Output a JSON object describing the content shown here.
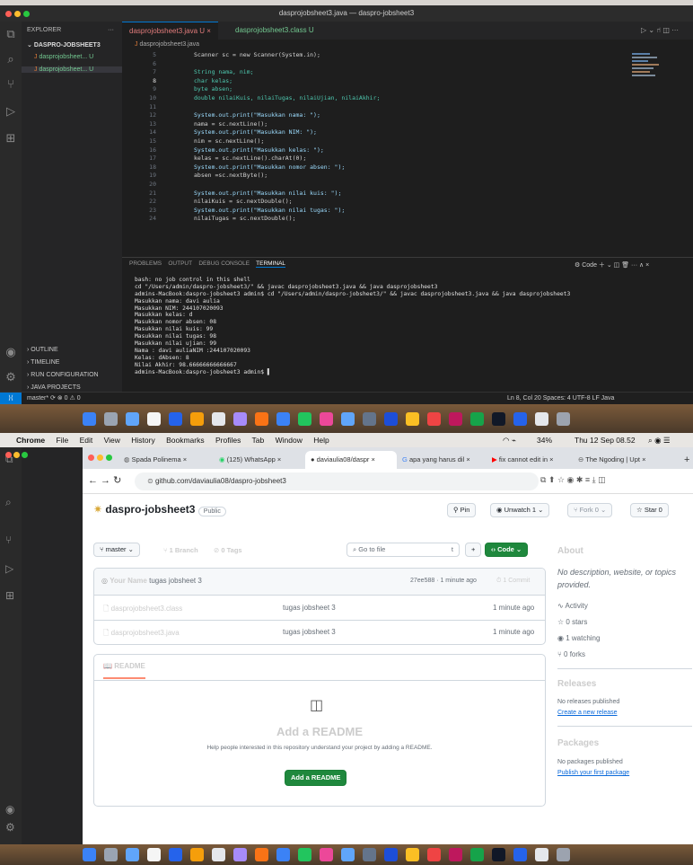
{
  "vscode": {
    "window_title": "dasprojobsheet3.java — daspro-jobsheet3",
    "explorer_label": "EXPLORER",
    "folder": "DASPRO-JOBSHEET3",
    "files": [
      {
        "name": "dasprojobsheet... U"
      },
      {
        "name": "dasprojobsheet... U"
      }
    ],
    "tabs": [
      "dasprojobsheet3.java U",
      "dasprojobsheet3.class U"
    ],
    "breadcrumb": "dasprojobsheet3.java",
    "line_numbers": [
      "5",
      "6",
      "7",
      "8",
      "9",
      "10",
      "11",
      "12",
      "13",
      "14",
      "15",
      "16",
      "17",
      "18",
      "19",
      "20",
      "21",
      "22",
      "23",
      "24"
    ],
    "code_lines": [
      "Scanner sc = new Scanner(System.in);",
      "",
      "String nama, nim;",
      "char kelas;",
      "byte absen;",
      "double nilaiKuis, nilaiTugas, nilaiUjian, nilaiAkhir;",
      "",
      "System.out.print(\"Masukkan nama: \");",
      "nama = sc.nextLine();",
      "System.out.print(\"Masukkan NIM: \");",
      "nim = sc.nextLine();",
      "System.out.print(\"Masukkan kelas: \");",
      "kelas = sc.nextLine().charAt(0);",
      "System.out.print(\"Masukkan nomor absen: \");",
      "absen =sc.nextByte();",
      "",
      "System.out.print(\"Masukkan nilai kuis: \");",
      "nilaiKuis = sc.nextDouble();",
      "System.out.print(\"Masukkan nilai tugas: \");",
      "nilaiTugas = sc.nextDouble();"
    ],
    "panel_tabs": [
      "PROBLEMS",
      "OUTPUT",
      "DEBUG CONSOLE",
      "TERMINAL"
    ],
    "panel_right": "Code",
    "terminal_lines": [
      "bash: no job control in this shell",
      "cd \"/Users/admin/daspro-jobsheet3/\" && javac dasprojobsheet3.java && java dasprojobsheet3",
      "admins-MacBook:daspro-jobsheet3 admin$ cd \"/Users/admin/daspro-jobsheet3/\" && javac dasprojobsheet3.java && java dasprojobsheet3",
      "Masukkan nama: davi aulia",
      "Masukkan NIM: 244107020093",
      "Masukkan kelas: d",
      "Masukkan nomor absen: 08",
      "Masukkan nilai kuis: 99",
      "Masukkan nilai tugas: 98",
      "Masukkan nilai ujian: 99",
      "Nama : davi auliaNIM :244107020093",
      "Kelas: dAbsen: 8",
      "Nilai Akhir: 98.66666666666667",
      "admins-MacBook:daspro-jobsheet3 admin$ ▌"
    ],
    "outline_sections": [
      "OUTLINE",
      "TIMELINE",
      "RUN CONFIGURATION",
      "JAVA PROJECTS"
    ],
    "status_left": "master*  ⟳  ⊗ 0 ⚠ 0",
    "status_right": "Ln 8, Col 20   Spaces: 4   UTF-8   LF   Java"
  },
  "mac_menu": {
    "items": [
      "Chrome",
      "File",
      "Edit",
      "View",
      "History",
      "Bookmarks",
      "Profiles",
      "Tab",
      "Window",
      "Help"
    ],
    "battery": "34%",
    "clock": "Thu 12 Sep  08.52"
  },
  "chrome": {
    "tabs": [
      "Spada Polinema",
      "(125) WhatsApp",
      "daviaulia08/daspr",
      "apa yang harus dil",
      "fix cannot edit in",
      "The Ngoding | Upt"
    ],
    "url": "github.com/daviaulia08/daspro-jobsheet3"
  },
  "github": {
    "repo_name": "daspro-jobsheet3",
    "visibility": "Public",
    "pin": "Pin",
    "unwatch": "Unwatch",
    "unwatch_count": "1",
    "fork": "Fork",
    "fork_count": "0",
    "star": "Star",
    "star_count": "0",
    "branch": "master",
    "branches": "1 Branch",
    "tags": "0 Tags",
    "goto_placeholder": "Go to file",
    "goto_key": "t",
    "code_btn": "Code",
    "commit_author": "Your Name",
    "commit_msg": "tugas jobsheet 3",
    "commit_meta": "27ee588 · 1 minute ago",
    "commit_count": "1 Commit",
    "files": [
      {
        "name": "dasprojobsheet3.class",
        "msg": "tugas jobsheet 3",
        "time": "1 minute ago"
      },
      {
        "name": "dasprojobsheet3.java",
        "msg": "tugas jobsheet 3",
        "time": "1 minute ago"
      }
    ],
    "readme_tab": "README",
    "readme_title": "Add a README",
    "readme_desc": "Help people interested in this repository understand your project by adding a README.",
    "readme_btn": "Add a README",
    "about_title": "About",
    "about_desc": "No description, website, or topics provided.",
    "about_items": [
      "Activity",
      "0 stars",
      "1 watching",
      "0 forks"
    ],
    "releases_title": "Releases",
    "releases_none": "No releases published",
    "releases_link": "Create a new release",
    "packages_title": "Packages",
    "packages_none": "No packages published",
    "packages_link": "Publish your first package"
  },
  "colors": {
    "vscode_bg": "#1e1e1e",
    "github_green": "#1f883d",
    "link": "#0969da"
  }
}
